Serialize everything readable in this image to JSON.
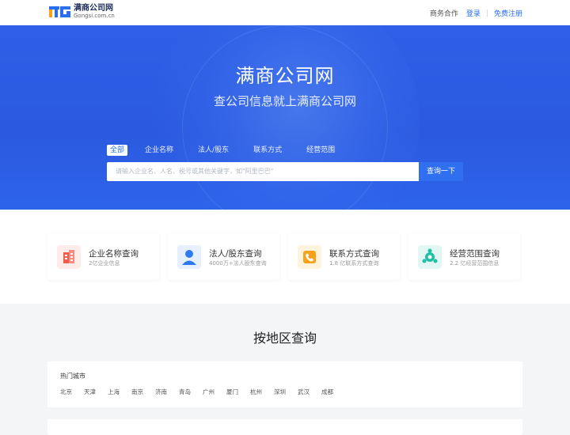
{
  "header": {
    "logo_mark": "TG",
    "logo_name": "满商公司网",
    "logo_domain": "Gongsi.com.cn",
    "links": {
      "business": "商务合作",
      "login": "登录",
      "separator": "|",
      "register": "免费注册"
    }
  },
  "hero": {
    "title": "满商公司网",
    "subtitle": "查公司信息就上满商公司网",
    "tabs": [
      "全部",
      "企业名称",
      "法人/股东",
      "联系方式",
      "经营范围"
    ],
    "active_tab": "全部",
    "search_placeholder": "请输入企业名、人名、税号或其他关键字，如\"阿里巴巴\"",
    "search_button": "查询一下"
  },
  "features": [
    {
      "title": "企业名称查询",
      "desc": "2亿企业信息",
      "icon": "building-icon",
      "color": "#f25a4a"
    },
    {
      "title": "法人/股东查询",
      "desc": "4000万+法人股东查询",
      "icon": "person-icon",
      "color": "#2f7af2"
    },
    {
      "title": "联系方式查询",
      "desc": "1.8 亿联系方式查询",
      "icon": "phone-icon",
      "color": "#f7a21b"
    },
    {
      "title": "经营范围查询",
      "desc": "2.2 亿经营范围信息",
      "icon": "network-icon",
      "color": "#1fbfa5"
    }
  ],
  "region": {
    "title": "按地区查询",
    "hot_label": "热门城市",
    "cities": [
      "北京",
      "天津",
      "上海",
      "南京",
      "济南",
      "青岛",
      "广州",
      "厦门",
      "杭州",
      "深圳",
      "武汉",
      "成都"
    ]
  },
  "colors": {
    "brand_blue": "#2b6ff0",
    "hero_bg": "#2b5ae0"
  }
}
